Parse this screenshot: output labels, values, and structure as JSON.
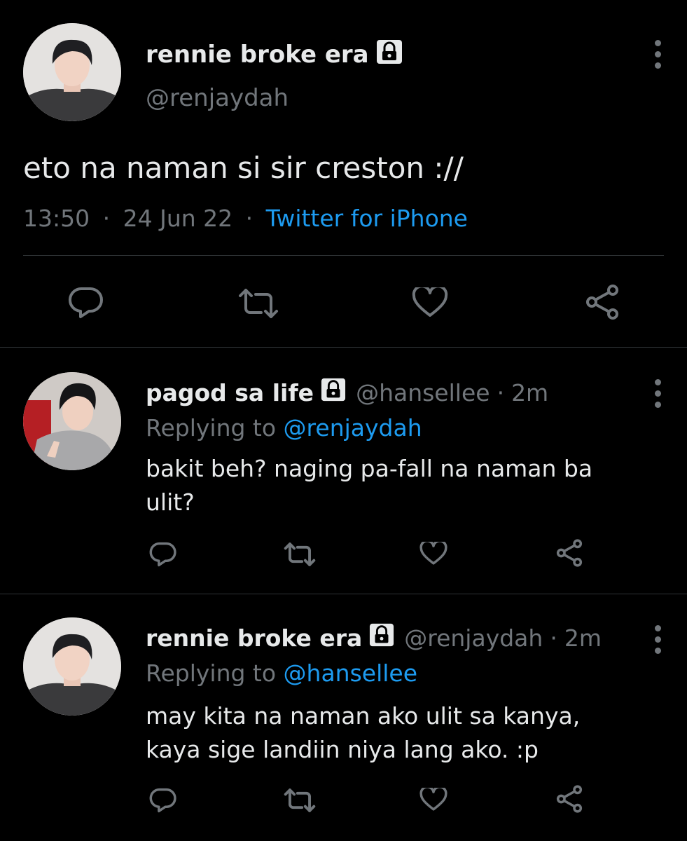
{
  "main_tweet": {
    "display_name": "rennie broke era",
    "handle": "@renjaydah",
    "text": "eto na naman si sir creston ://",
    "time": "13:50",
    "sep1": "·",
    "date": "24 Jun 22",
    "sep2": "·",
    "source": "Twitter for iPhone",
    "actions": [
      "reply-icon",
      "retweet-icon",
      "like-icon",
      "share-icon"
    ]
  },
  "replies": [
    {
      "display_name": "pagod sa life",
      "handle": "@hansellee",
      "sep": "·",
      "time": "2m",
      "replying_prefix": "Replying to",
      "replying_to": "@renjaydah",
      "text_line1": "bakit beh? naging pa-fall na naman ba",
      "text_line2": "ulit?"
    },
    {
      "display_name": "rennie broke era",
      "handle": "@renjaydah",
      "sep": "·",
      "time": "2m",
      "replying_prefix": "Replying to",
      "replying_to": "@hansellee",
      "text_line1": "may kita na naman ako ulit sa kanya,",
      "text_line2": "kaya sige landiin niya lang ako. :p"
    }
  ],
  "colors": {
    "background": "#000000",
    "text": "#e7e9ea",
    "muted": "#71767b",
    "accent": "#1d9bf0",
    "divider": "#2f3336"
  }
}
